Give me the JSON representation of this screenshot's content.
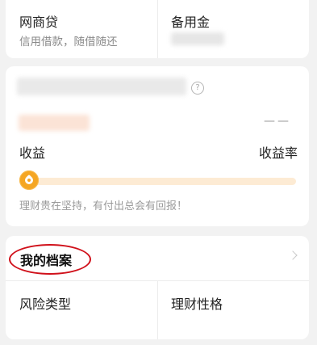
{
  "loans": {
    "left": {
      "title": "网商贷",
      "subtitle": "信用借款，随借随还"
    },
    "right": {
      "title": "备用金"
    }
  },
  "earnings": {
    "help_icon": "question-circle-icon",
    "yield_value": "——",
    "label_income": "收益",
    "label_yield": "收益率",
    "progress_fraction": 0.0,
    "motto": "理财贵在坚持，有付出总会有回报！",
    "accent_color": "#f5a623",
    "track_color": "#fdebd4"
  },
  "profile": {
    "title": "我的档案",
    "chevron_icon": "chevron-right-icon",
    "highlight_color": "#d0101a",
    "items": [
      {
        "label": "风险类型"
      },
      {
        "label": "理财性格"
      }
    ]
  }
}
